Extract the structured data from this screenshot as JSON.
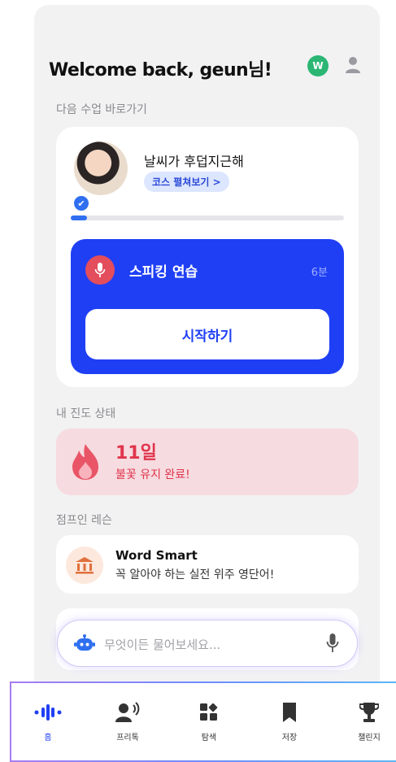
{
  "header": {
    "welcome": "Welcome back, geun님!",
    "badge": "W"
  },
  "next_class": {
    "section_label": "다음 수업 바로가기",
    "lesson_title": "날씨가 후덥지근해",
    "course_button": "코스 펼쳐보기 >",
    "progress_fraction": 0.06,
    "speaking": {
      "title": "스피킹 연습",
      "duration": "6분",
      "start_button": "시작하기"
    }
  },
  "progress": {
    "section_label": "내 진도 상태",
    "streak_days": "11일",
    "streak_text": "불꽃 유지 완료!"
  },
  "jump_in": {
    "section_label": "점프인 레슨",
    "title": "Word Smart",
    "subtitle": "꼭 알아야 하는 실전 위주 영단어!"
  },
  "ask": {
    "placeholder": "무엇이든 물어보세요..."
  },
  "tabs": [
    {
      "label": "홈",
      "icon": "voice-wave-icon"
    },
    {
      "label": "프리톡",
      "icon": "speaking-person-icon"
    },
    {
      "label": "탐색",
      "icon": "grid-icon"
    },
    {
      "label": "저장",
      "icon": "bookmark-icon"
    },
    {
      "label": "챌린지",
      "icon": "trophy-icon"
    }
  ],
  "colors": {
    "accent": "#1f3ff5",
    "streak": "#e0354c",
    "badge": "#2bb673"
  }
}
